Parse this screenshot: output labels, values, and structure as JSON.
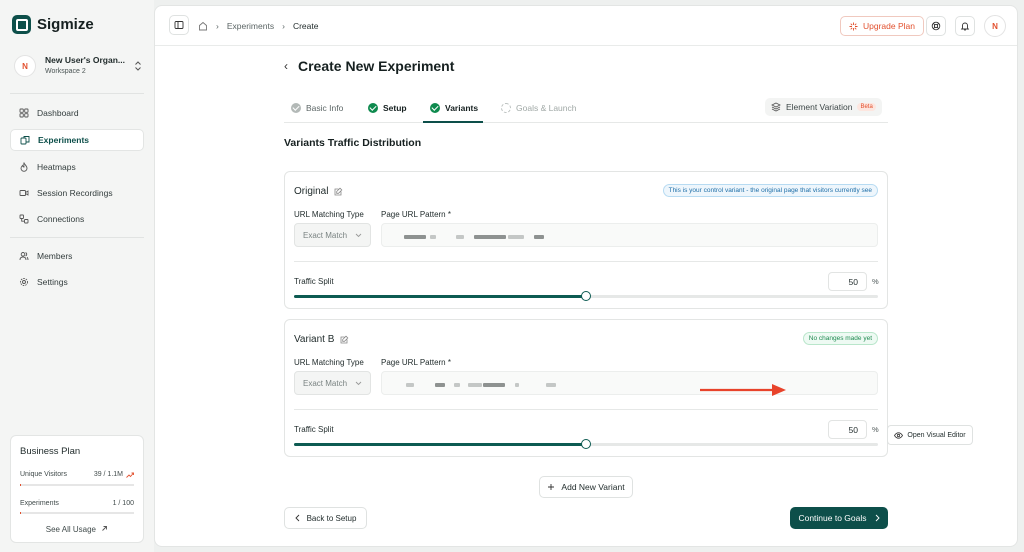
{
  "brand": {
    "name": "Sigmize"
  },
  "org": {
    "initial": "N",
    "name": "New User's Organ...",
    "workspace": "Workspace 2"
  },
  "nav": {
    "dashboard": "Dashboard",
    "experiments": "Experiments",
    "heatmaps": "Heatmaps",
    "session_recordings": "Session Recordings",
    "connections": "Connections",
    "members": "Members",
    "settings": "Settings"
  },
  "plan": {
    "title": "Business Plan",
    "visitors_label": "Unique Visitors",
    "visitors_value": "39 / 1.1M",
    "visitors_fraction": 4e-05,
    "experiments_label": "Experiments",
    "experiments_value": "1 / 100",
    "experiments_fraction": 0.01,
    "see_usage": "See All Usage"
  },
  "breadcrumb": {
    "section": "Experiments",
    "current": "Create"
  },
  "topbar": {
    "upgrade": "Upgrade Plan",
    "avatar": "N"
  },
  "page": {
    "title": "Create New Experiment"
  },
  "tabs": {
    "basic": "Basic Info",
    "setup": "Setup",
    "variants": "Variants",
    "goals": "Goals & Launch",
    "element_variation": "Element Variation",
    "beta": "Beta"
  },
  "section_title": "Variants Traffic Distribution",
  "labels": {
    "url_matching": "URL Matching Type",
    "url_pattern": "Page URL Pattern *",
    "traffic_split": "Traffic Split",
    "percent": "%"
  },
  "variants": [
    {
      "name": "Original",
      "badge": "This is your control variant - the original page that visitors currently see",
      "match_type": "Exact Match",
      "split": "50",
      "split_fraction": 0.5
    },
    {
      "name": "Variant B",
      "badge": "No changes made yet",
      "match_type": "Exact Match",
      "split": "50",
      "split_fraction": 0.5,
      "editor_button": "Open Visual Editor"
    }
  ],
  "actions": {
    "add_variant": "Add New Variant",
    "back": "Back to Setup",
    "continue": "Continue to Goals"
  },
  "colors": {
    "brand": "#0d4f4a",
    "accent": "#e2502e",
    "success": "#0e8a4e"
  }
}
